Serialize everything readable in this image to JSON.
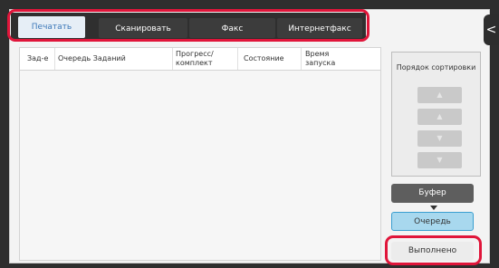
{
  "tabs": [
    {
      "label": "Печатать",
      "active": true
    },
    {
      "label": "Сканировать",
      "active": false
    },
    {
      "label": "Факс",
      "active": false
    },
    {
      "label": "Интернетфакс",
      "active": false
    }
  ],
  "table": {
    "headers": {
      "priority": "Зад-е",
      "queue": "Очередь Заданий",
      "progress": "Прогресс/ комплект",
      "status": "Состояние",
      "start_time": "Время запуска"
    },
    "rows": []
  },
  "sort_panel": {
    "title": "Порядок сортировки",
    "buttons": [
      {
        "icon": "double-up-arrow-icon",
        "glyph": "▲"
      },
      {
        "icon": "up-arrow-icon",
        "glyph": "▲"
      },
      {
        "icon": "down-arrow-icon",
        "glyph": "▼"
      },
      {
        "icon": "double-down-arrow-icon",
        "glyph": "▼"
      }
    ]
  },
  "side_buttons": {
    "buffer": "Буфер",
    "queue": "Очередь",
    "done": "Выполнено"
  },
  "side_handle": {
    "icon": "chevron-left-icon",
    "glyph": "<"
  },
  "colors": {
    "highlight": "#e0153a",
    "active_tab_text": "#3b77b8",
    "queue_selected": "#a8d8ee"
  }
}
